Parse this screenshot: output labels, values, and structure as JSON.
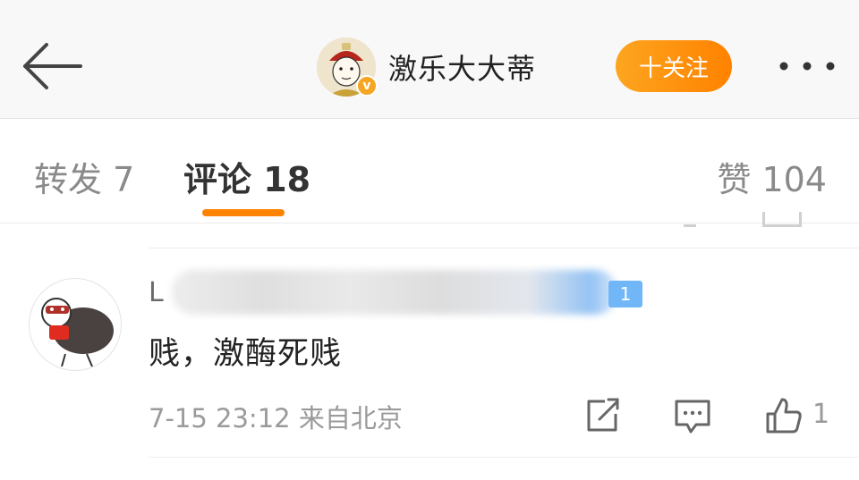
{
  "header": {
    "profile_name": "激乐大大蒂",
    "verified_mark": "v",
    "follow_label": "十关注"
  },
  "tabs": {
    "repost": "转发 7",
    "comment": "评论 18",
    "like": "赞 104"
  },
  "comment": {
    "username_visible": "L",
    "level_badge": "1",
    "text": "贱，激酶死贱",
    "meta": "7-15 23:12 来自北京",
    "like_count": "1"
  },
  "colors": {
    "accent": "#ff8200",
    "badge_blue": "#71b6f7",
    "text_muted": "#9a9a9a"
  },
  "icons": [
    "back-arrow-icon",
    "more-dots-icon",
    "verified-icon",
    "share-icon",
    "comment-icon",
    "thumbs-up-icon"
  ]
}
